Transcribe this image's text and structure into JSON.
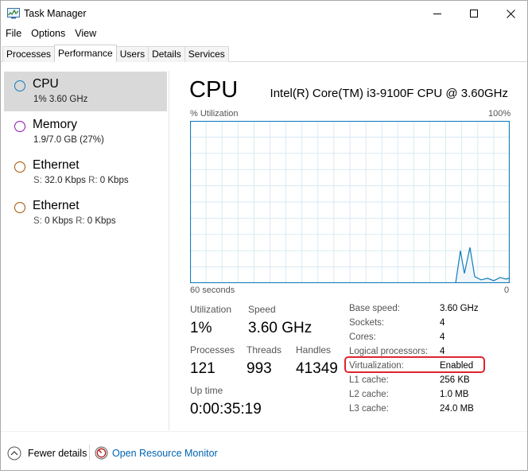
{
  "window": {
    "title": "Task Manager"
  },
  "menu": [
    "File",
    "Options",
    "View"
  ],
  "tabs": [
    {
      "label": "Processes",
      "active": false
    },
    {
      "label": "Performance",
      "active": true
    },
    {
      "label": "Users",
      "active": false
    },
    {
      "label": "Details",
      "active": false
    },
    {
      "label": "Services",
      "active": false
    }
  ],
  "sidebar": [
    {
      "title": "CPU",
      "sub_value": "1% 3.60 GHz",
      "color": "#117dbb",
      "selected": true
    },
    {
      "title": "Memory",
      "sub_value": "1.9/7.0 GB (27%)",
      "color": "#8b12ae",
      "selected": false
    },
    {
      "title": "Ethernet",
      "s_label": "S:",
      "s_value": "32.0 Kbps",
      "r_label": "R:",
      "r_value": "0 Kbps",
      "color": "#a74f01",
      "selected": false
    },
    {
      "title": "Ethernet",
      "s_label": "S:",
      "s_value": "0 Kbps",
      "r_label": "R:",
      "r_value": "0 Kbps",
      "color": "#a74f01",
      "selected": false
    }
  ],
  "main": {
    "title": "CPU",
    "cpu_name": "Intel(R) Core(TM) i3-9100F CPU @ 3.60GHz",
    "graph": {
      "y_label": "% Utilization",
      "y_max_label": "100%",
      "x_left_label": "60 seconds",
      "x_right_label": "0",
      "line_color": "#117dbb",
      "fill_color": "#f1f6fa"
    },
    "stats": {
      "utilization_label": "Utilization",
      "utilization_value": "1%",
      "speed_label": "Speed",
      "speed_value": "3.60 GHz",
      "processes_label": "Processes",
      "processes_value": "121",
      "threads_label": "Threads",
      "threads_value": "993",
      "handles_label": "Handles",
      "handles_value": "41349",
      "uptime_label": "Up time",
      "uptime_value": "0:00:35:19"
    },
    "info": [
      {
        "label": "Base speed:",
        "value": "3.60 GHz"
      },
      {
        "label": "Sockets:",
        "value": "4"
      },
      {
        "label": "Cores:",
        "value": "4"
      },
      {
        "label": "Logical processors:",
        "value": "4"
      },
      {
        "label": "Virtualization:",
        "value": "Enabled"
      },
      {
        "label": "L1 cache:",
        "value": "256 KB"
      },
      {
        "label": "L2 cache:",
        "value": "1.0 MB"
      },
      {
        "label": "L3 cache:",
        "value": "24.0 MB"
      }
    ],
    "highlight_color": "#e0242f"
  },
  "footer": {
    "fewer_details": "Fewer details",
    "open_resource_monitor": "Open Resource Monitor"
  }
}
